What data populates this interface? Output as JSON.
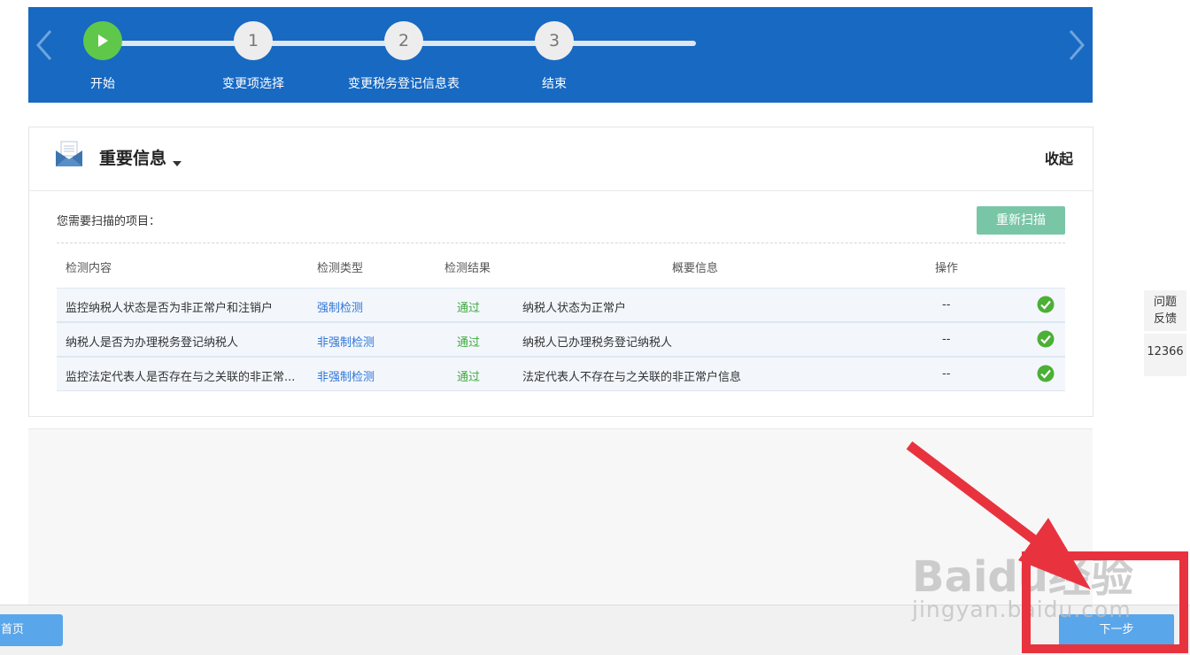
{
  "stepper": {
    "steps": [
      {
        "number": "",
        "label": "开始",
        "state": "active"
      },
      {
        "number": "1",
        "label": "变更项选择",
        "state": "pending"
      },
      {
        "number": "2",
        "label": "变更税务登记信息表",
        "state": "pending"
      },
      {
        "number": "3",
        "label": "结束",
        "state": "pending"
      }
    ],
    "colors": {
      "bar": "#1769c2",
      "active": "#5fc84a"
    }
  },
  "panel": {
    "title": "重要信息",
    "collapse_label": "收起",
    "scan_label": "您需要扫描的项目：",
    "rescan_label": "重新扫描",
    "columns": [
      "检测内容",
      "检测类型",
      "检测结果",
      "概要信息",
      "操作"
    ],
    "rows": [
      {
        "content": "监控纳税人状态是否为非正常户和注销户",
        "type": "强制检测",
        "result": "通过",
        "summary": "纳税人状态为正常户",
        "op": "--"
      },
      {
        "content": "纳税人是否为办理税务登记纳税人",
        "type": "非强制检测",
        "result": "通过",
        "summary": "纳税人已办理税务登记纳税人",
        "op": "--"
      },
      {
        "content": "监控法定代表人是否存在与之关联的非正常...",
        "type": "非强制检测",
        "result": "通过",
        "summary": "法定代表人不存在与之关联的非正常户信息",
        "op": "--"
      }
    ]
  },
  "side": {
    "feedback_line1": "问题",
    "feedback_line2": "反馈",
    "hotline": "12366"
  },
  "footer": {
    "home_label": "回首页",
    "next_label": "下一步"
  },
  "watermark": {
    "logo": "Baidu经验",
    "url": "jingyan.baidu.com"
  },
  "annotation_color": "#e8333f"
}
